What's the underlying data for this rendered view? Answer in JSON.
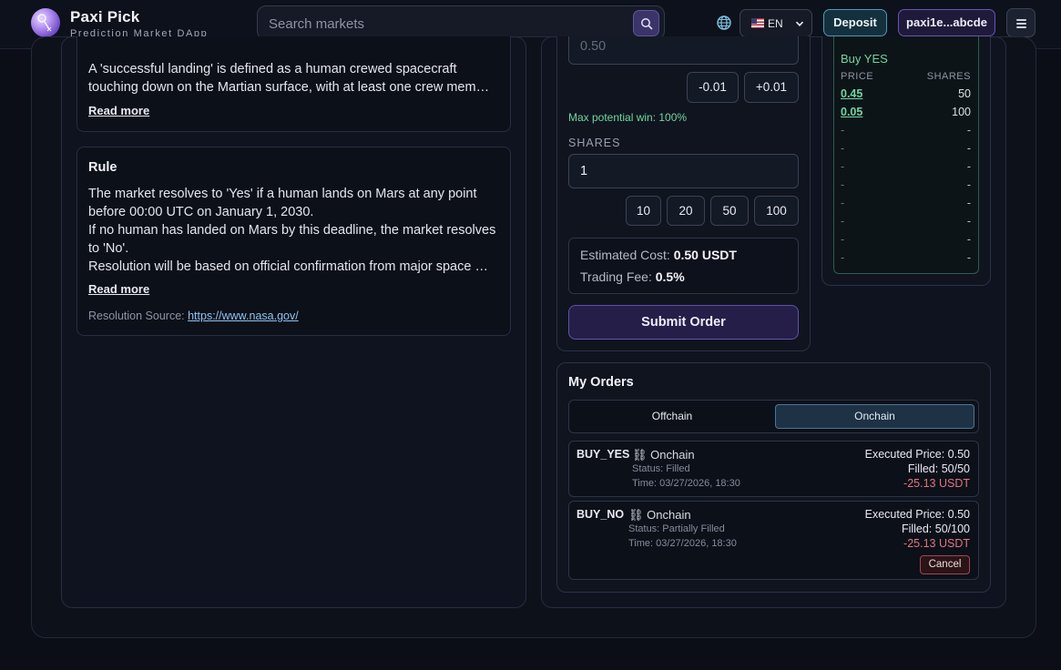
{
  "header": {
    "brand_title": "Paxi Pick",
    "brand_subtitle": "Prediction Market DApp",
    "search_placeholder": "Search markets",
    "language": "EN",
    "deposit_label": "Deposit",
    "wallet_label": "paxi1e...abcde"
  },
  "description": {
    "text_line1": "A 'successful landing' is defined as a human crewed spacecraft",
    "text_line2": "touching down on the Martian surface, with at least one crew memb…",
    "read_more": "Read more"
  },
  "rule": {
    "heading": "Rule",
    "line1": "The market resolves to 'Yes' if a human lands on Mars at any point",
    "line2": "before 00:00 UTC on January 1, 2030.",
    "line3": "If no human has landed on Mars by this deadline, the market resolves",
    "line4": "to 'No'.",
    "line5": "Resolution will be based on official confirmation from major space …",
    "read_more": "Read more",
    "source_label": "Resolution Source:",
    "source_url": "https://www.nasa.gov/"
  },
  "trade": {
    "price_value": "0.50",
    "price_decrement": "-0.01",
    "price_increment": "+0.01",
    "max_win": "Max potential win: 100%",
    "shares_label": "SHARES",
    "shares_value": "1",
    "preset_10": "10",
    "preset_20": "20",
    "preset_50": "50",
    "preset_100": "100",
    "est_cost_label": "Estimated Cost:",
    "est_cost_value": "0.50 USDT",
    "fee_label": "Trading Fee:",
    "fee_value": "0.5%",
    "submit_label": "Submit Order"
  },
  "orderbook": {
    "title": "Buy YES",
    "col_price": "PRICE",
    "col_shares": "SHARES",
    "rows": [
      {
        "price": "0.45",
        "shares": "50"
      },
      {
        "price": "0.05",
        "shares": "100"
      },
      {
        "price": "-",
        "shares": "-"
      },
      {
        "price": "-",
        "shares": "-"
      },
      {
        "price": "-",
        "shares": "-"
      },
      {
        "price": "-",
        "shares": "-"
      },
      {
        "price": "-",
        "shares": "-"
      },
      {
        "price": "-",
        "shares": "-"
      },
      {
        "price": "-",
        "shares": "-"
      },
      {
        "price": "-",
        "shares": "-"
      }
    ]
  },
  "orders": {
    "title": "My Orders",
    "tab_offchain": "Offchain",
    "tab_onchain": "Onchain",
    "items": [
      {
        "side": "BUY_YES",
        "chain": "Onchain",
        "status": "Status: Filled",
        "time": "Time: 03/27/2026, 18:30",
        "executed": "Executed Price: 0.50",
        "filled": "Filled: 50/50",
        "amount": "-25.13 USDT"
      },
      {
        "side": "BUY_NO",
        "chain": "Onchain",
        "status": "Status: Partially Filled",
        "time": "Time: 03/27/2026, 18:30",
        "executed": "Executed Price: 0.50",
        "filled": "Filled: 50/100",
        "amount": "-25.13 USDT",
        "cancel": "Cancel"
      }
    ]
  },
  "colors": {
    "background": "#0b0e16",
    "accent_purple": "#5f52aa",
    "accent_teal": "#4a9ab4",
    "buy_green": "#6fd6a0",
    "negative_red": "#e0757e"
  }
}
